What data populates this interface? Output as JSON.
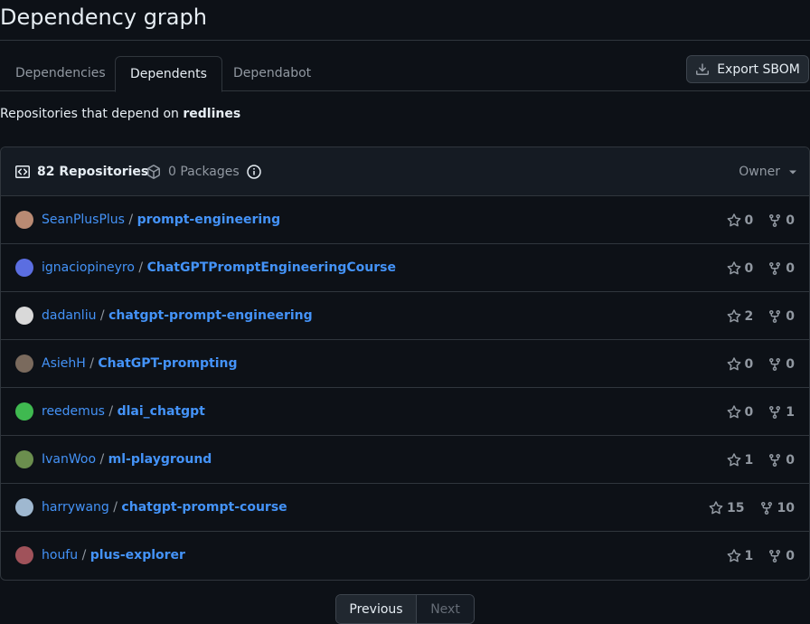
{
  "page": {
    "title": "Dependency graph"
  },
  "tabs": [
    {
      "label": "Dependencies",
      "selected": false
    },
    {
      "label": "Dependents",
      "selected": true
    },
    {
      "label": "Dependabot",
      "selected": false
    }
  ],
  "export_button": {
    "label": "Export SBOM",
    "icon": "download-icon"
  },
  "intro": {
    "prefix": "Repositories that depend on ",
    "package": "redlines"
  },
  "header": {
    "repos_label": "82 Repositories",
    "packages_label": "0 Packages",
    "owner_label": "Owner"
  },
  "rows": [
    {
      "owner": "SeanPlusPlus",
      "repo": "prompt-engineering",
      "stars": "0",
      "forks": "0",
      "avatar_color": "#b98a73"
    },
    {
      "owner": "ignaciopineyro",
      "repo": "ChatGPTPromptEngineeringCourse",
      "stars": "0",
      "forks": "0",
      "avatar_color": "#5b6ee1"
    },
    {
      "owner": "dadanliu",
      "repo": "chatgpt-prompt-engineering",
      "stars": "2",
      "forks": "0",
      "avatar_color": "#d9d9d9"
    },
    {
      "owner": "AsiehH",
      "repo": "ChatGPT-prompting",
      "stars": "0",
      "forks": "0",
      "avatar_color": "#7a6a5d"
    },
    {
      "owner": "reedemus",
      "repo": "dlai_chatgpt",
      "stars": "0",
      "forks": "1",
      "avatar_color": "#3fb950"
    },
    {
      "owner": "IvanWoo",
      "repo": "ml-playground",
      "stars": "1",
      "forks": "0",
      "avatar_color": "#6b8e4e"
    },
    {
      "owner": "harrywang",
      "repo": "chatgpt-prompt-course",
      "stars": "15",
      "forks": "10",
      "avatar_color": "#9fb8d0"
    },
    {
      "owner": "houfu",
      "repo": "plus-explorer",
      "stars": "1",
      "forks": "0",
      "avatar_color": "#a0525a"
    }
  ],
  "pagination": {
    "previous": "Previous",
    "next": "Next"
  }
}
